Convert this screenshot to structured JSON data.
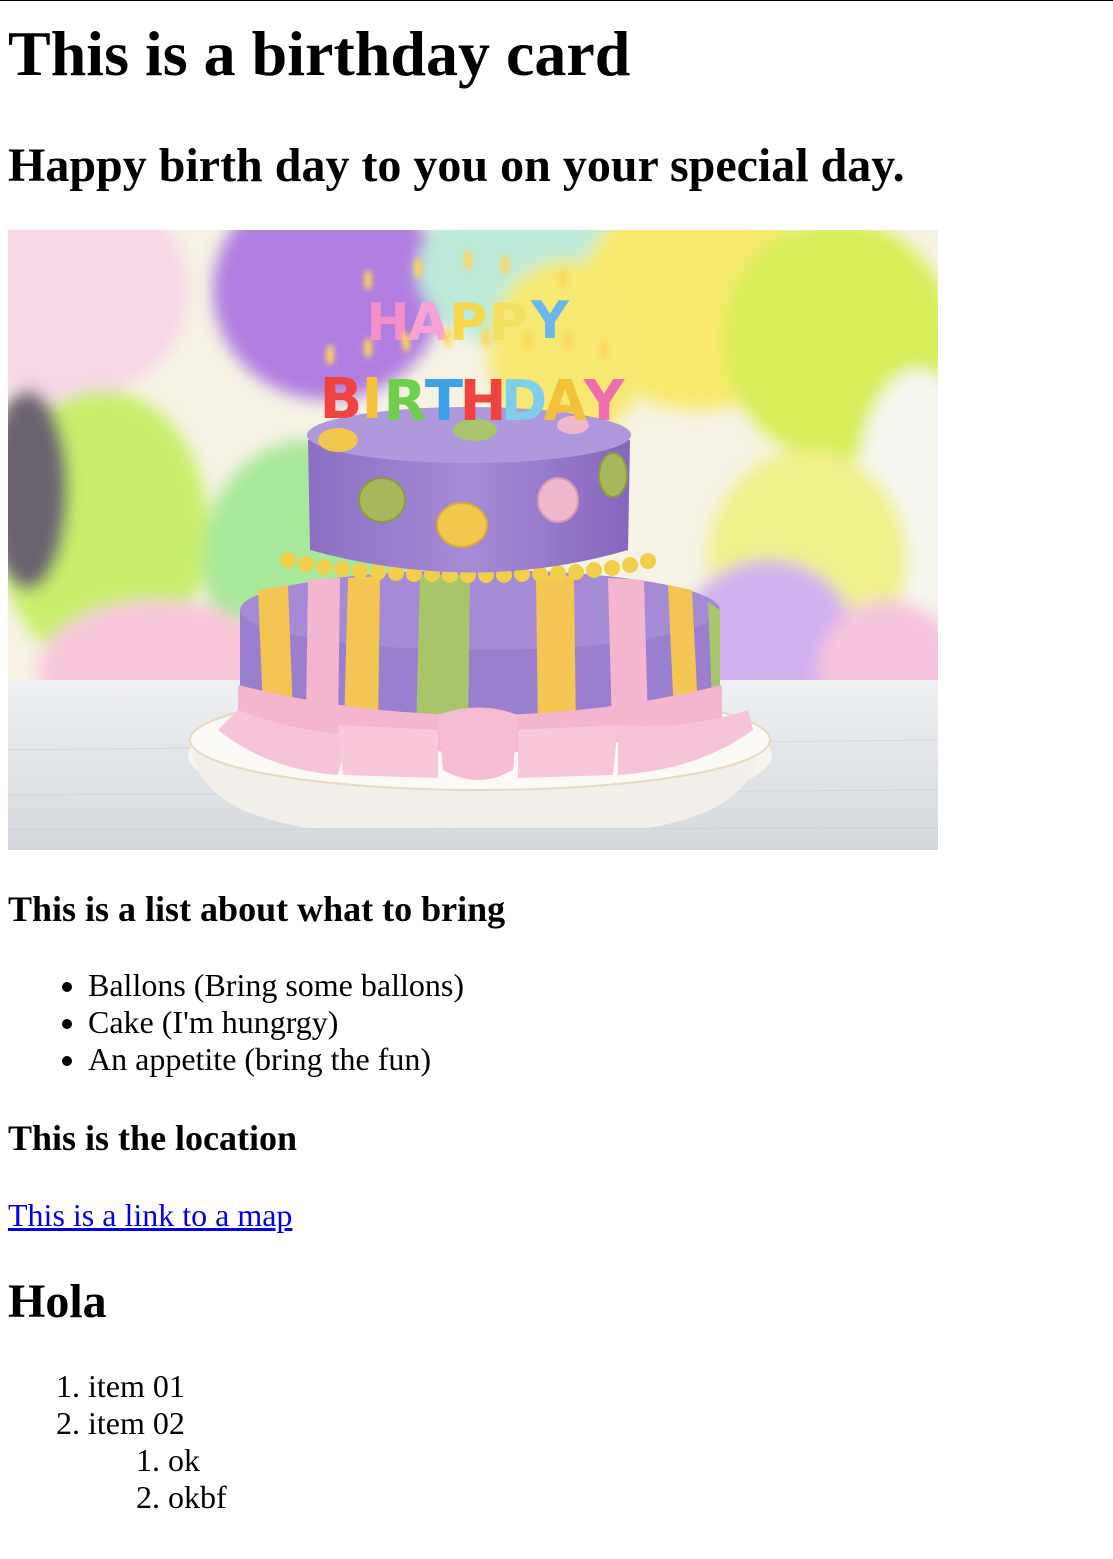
{
  "title": "This is a birthday card",
  "subtitle": "Happy birth day to you on your special day.",
  "photo": {
    "cake_candle_rows": [
      "HAPPY",
      "BIRTHDAY"
    ],
    "colors": {
      "cake_purple": "#9b7fcf",
      "ribbon_pink": "#f4b6cf",
      "ribbon_yellow": "#f3c552",
      "ribbon_green": "#a8c56a",
      "balloon_purple": "#b07ee0",
      "balloon_lime": "#d9ee5a",
      "balloon_green": "#a6dd6a",
      "balloon_yellow": "#f6e870"
    }
  },
  "bring": {
    "heading": "This is a list about what to bring",
    "items": [
      "Ballons (Bring some ballons)",
      "Cake (I'm hungrgy)",
      "An appetite (bring the fun)"
    ]
  },
  "location": {
    "heading": "This is the location",
    "link_text": "This is a link to a map",
    "link_color": "#0000ee"
  },
  "hola": {
    "heading": "Hola",
    "items": [
      "item 01",
      "item 02"
    ],
    "subitems": [
      "ok",
      "okbf"
    ]
  }
}
